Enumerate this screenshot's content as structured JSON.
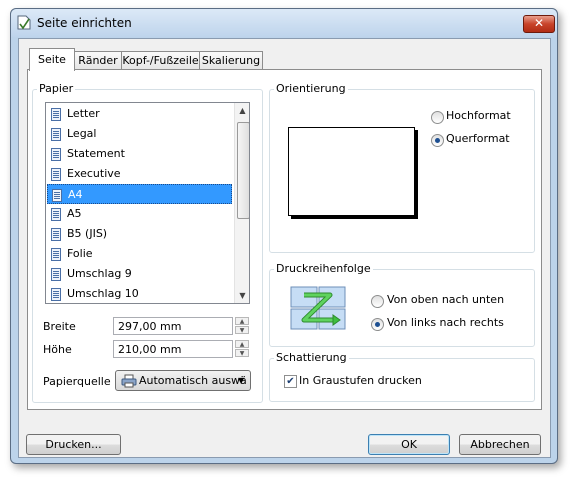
{
  "window": {
    "title": "Seite einrichten",
    "close_glyph": "✕"
  },
  "tabs": [
    {
      "label": "Seite",
      "active": true
    },
    {
      "label": "Ränder",
      "active": false
    },
    {
      "label": "Kopf-/Fußzeile",
      "active": false
    },
    {
      "label": "Skalierung",
      "active": false
    }
  ],
  "paper": {
    "group_label": "Papier",
    "items": [
      "Letter",
      "Legal",
      "Statement",
      "Executive",
      "A4",
      "A5",
      "B5 (JIS)",
      "Folie",
      "Umschlag 9",
      "Umschlag 10"
    ],
    "selected": "A4",
    "width_label": "Breite",
    "width_value": "297,00 mm",
    "height_label": "Höhe",
    "height_value": "210,00 mm",
    "source_label": "Papierquelle",
    "source_value": "Automatisch auswä"
  },
  "orientation": {
    "group_label": "Orientierung",
    "portrait_label": "Hochformat",
    "landscape_label": "Querformat",
    "selected": "landscape"
  },
  "print_order": {
    "group_label": "Druckreihenfolge",
    "top_down_label": "Von oben nach unten",
    "left_right_label": "Von links nach rechts",
    "selected": "left_right",
    "icon": "z-order-icon"
  },
  "shading": {
    "group_label": "Schattierung",
    "grayscale_label": "In Graustufen drucken",
    "grayscale_checked": true
  },
  "buttons": {
    "print": "Drucken...",
    "ok": "OK",
    "cancel": "Abbrechen"
  },
  "colors": {
    "selection": "#3399ff",
    "arrow_green": "#3fbf3f",
    "tile_blue": "#c6ddf5"
  }
}
